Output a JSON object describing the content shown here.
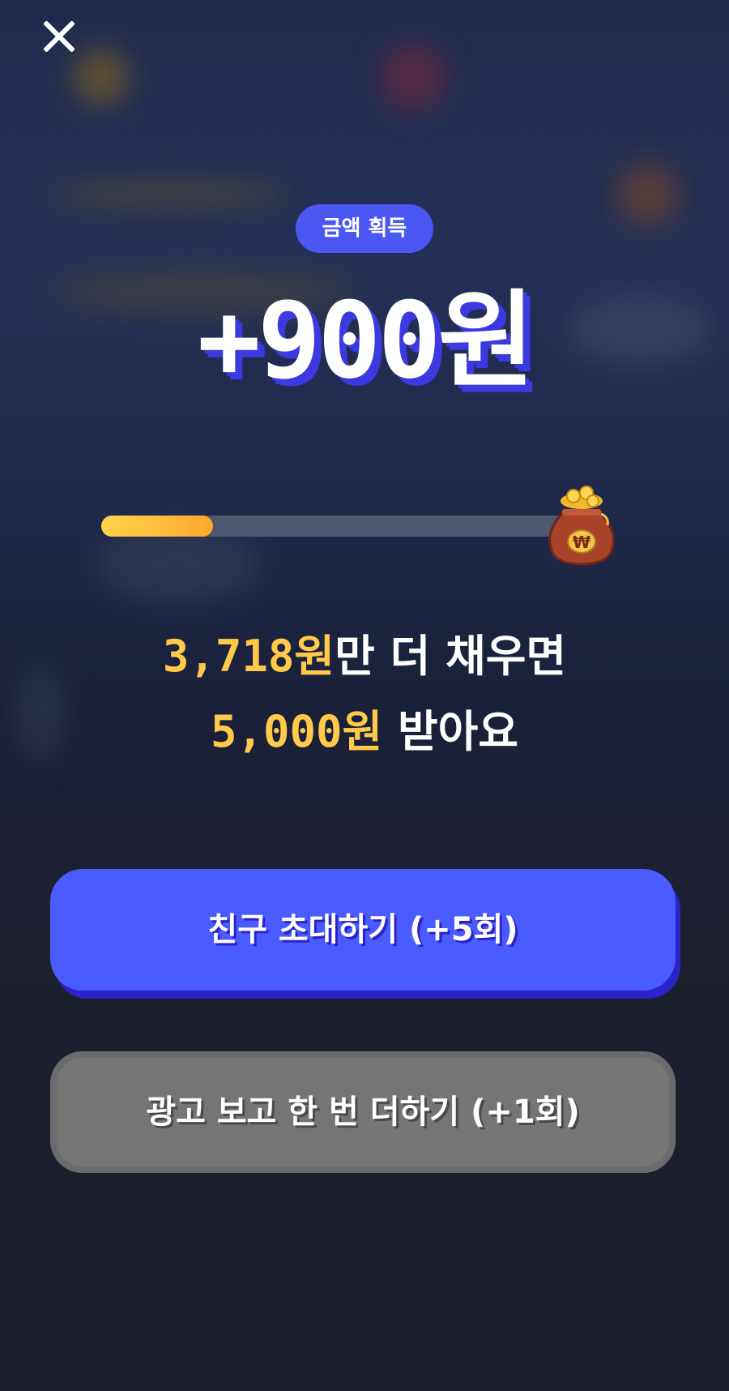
{
  "close": {
    "icon": "close-icon"
  },
  "badge": {
    "label": "금액 획득"
  },
  "amount": {
    "text": "+900원"
  },
  "progress": {
    "fraction": 0.24,
    "icon": "money-bag-icon",
    "bag_symbol": "₩"
  },
  "message": {
    "line1_highlight": "3,718원",
    "line1_rest": "만 더 채우면",
    "line2_highlight": "5,000원",
    "line2_rest": " 받아요"
  },
  "buttons": {
    "invite_label": "친구 초대하기 (+5회)",
    "ad_label": "광고 보고 한 번 더하기 (+1회)"
  },
  "colors": {
    "accent": "#4a5cff",
    "highlight": "#ffc94a",
    "progress": "#ffb52f",
    "secondary_button": "#757575"
  }
}
